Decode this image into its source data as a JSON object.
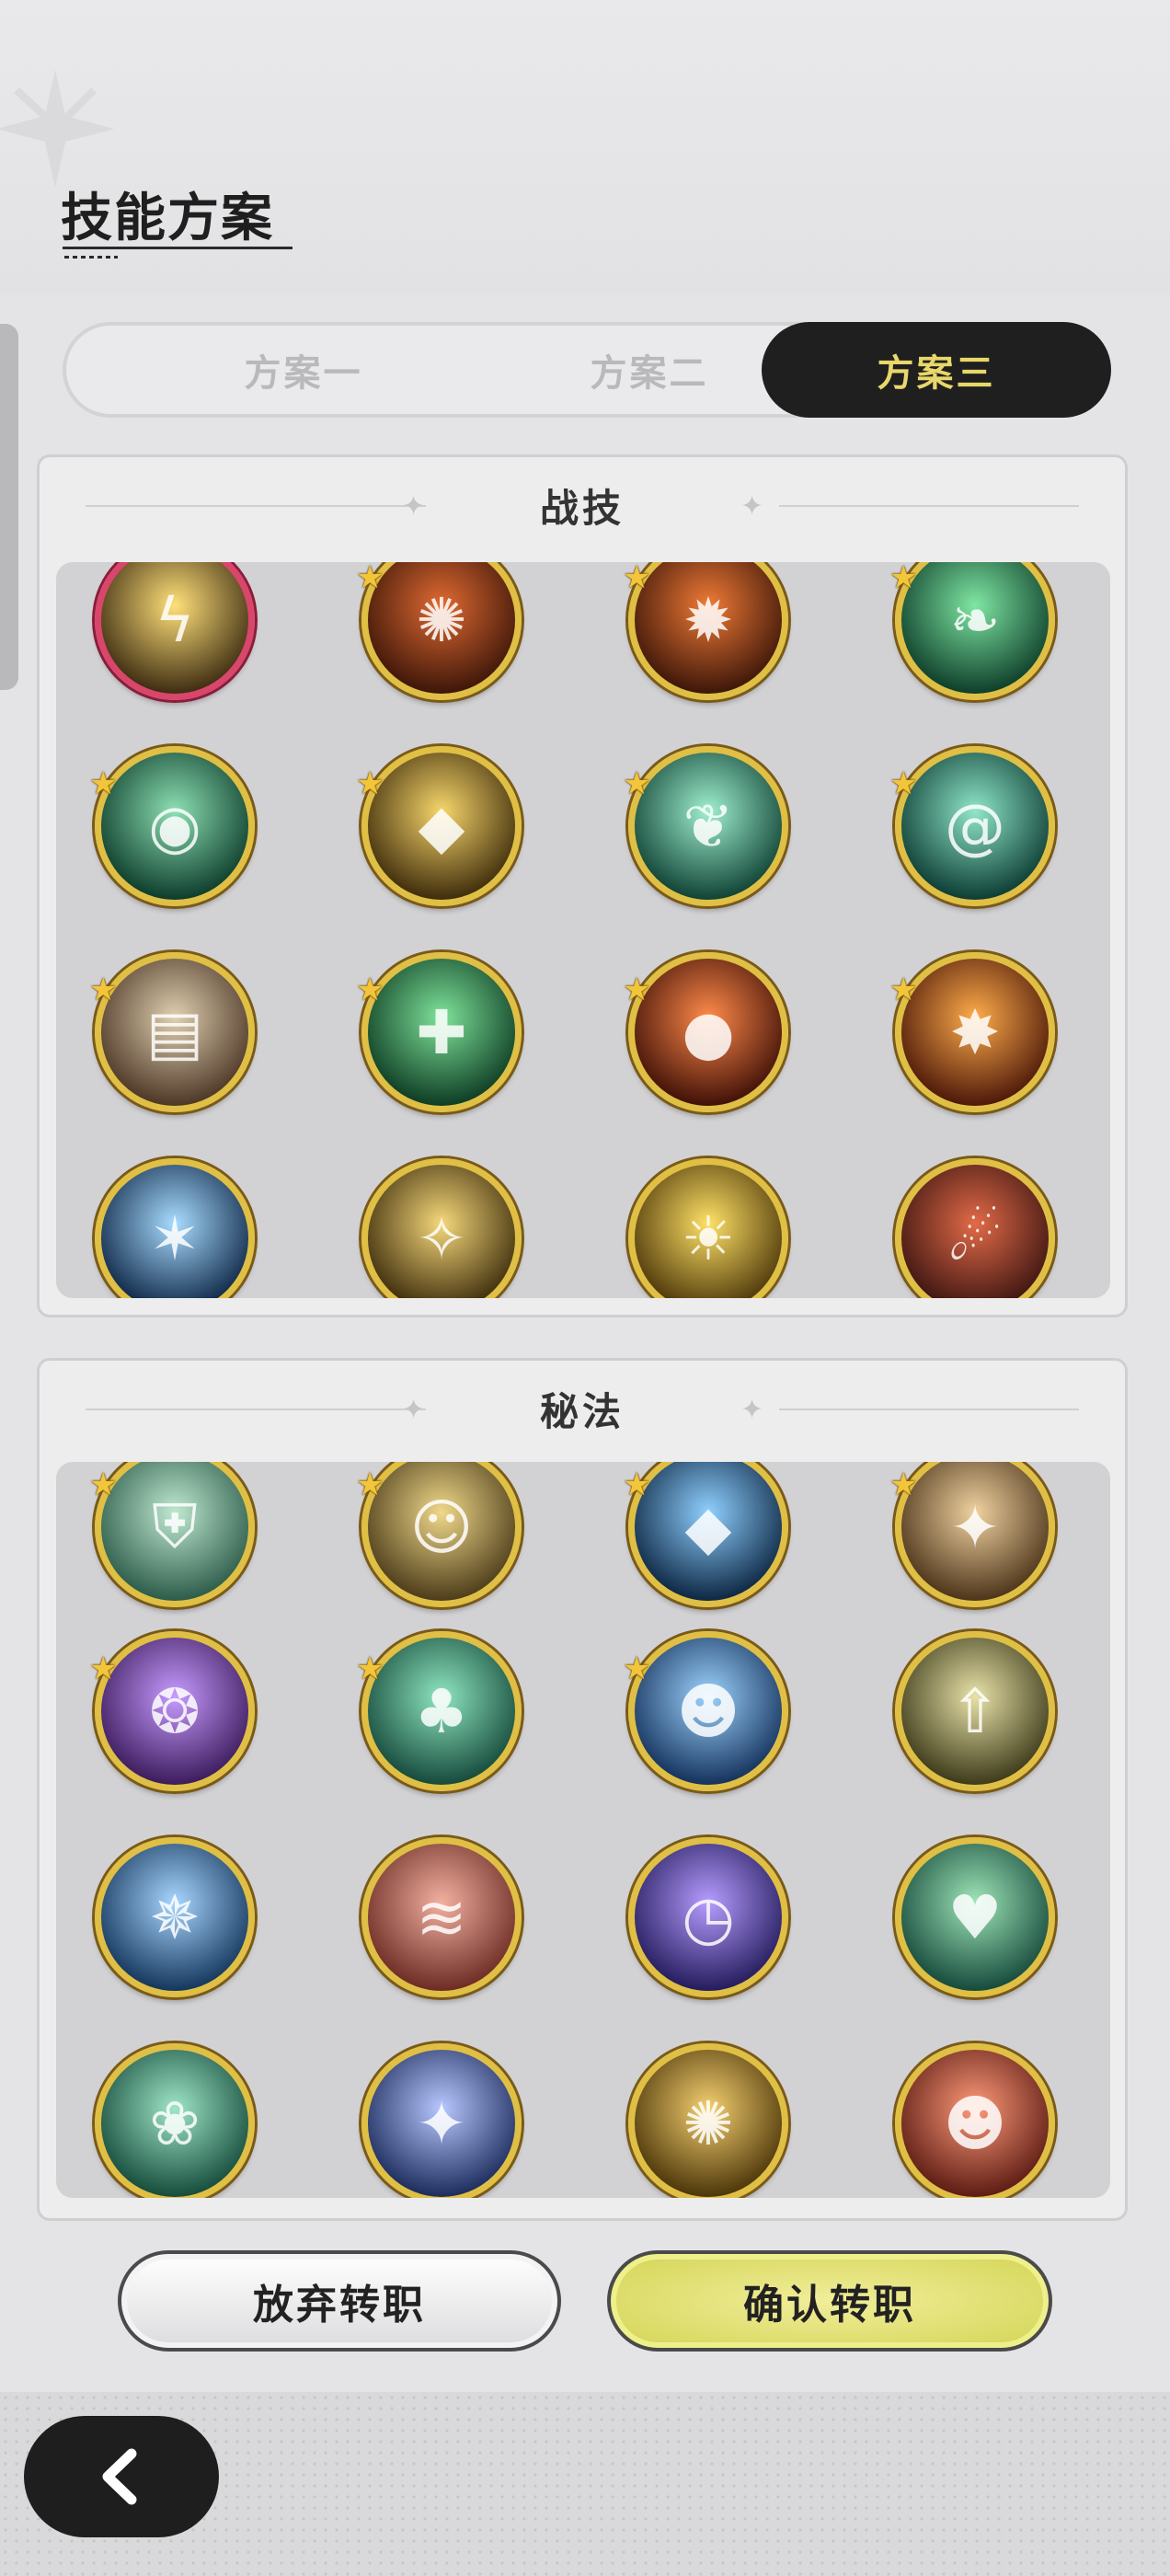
{
  "header": {
    "title": "技能方案"
  },
  "tabs": [
    {
      "label": "方案一",
      "active": false
    },
    {
      "label": "方案二",
      "active": false
    },
    {
      "label": "方案三",
      "active": true
    }
  ],
  "battle_section": {
    "title": "战技",
    "skills": [
      {
        "icon": "lightning-skill-icon",
        "symbol": "ϟ",
        "colors": [
          "#ffe07a",
          "#3b2a10"
        ],
        "starred": false,
        "selected": true
      },
      {
        "icon": "fire-swirl-icon",
        "symbol": "✺",
        "colors": [
          "#e06a32",
          "#3b1508"
        ],
        "starred": true,
        "selected": false
      },
      {
        "icon": "fire-mountain-icon",
        "symbol": "✹",
        "colors": [
          "#f07a36",
          "#3a1508"
        ],
        "starred": true,
        "selected": false
      },
      {
        "icon": "green-wind-icon",
        "symbol": "❧",
        "colors": [
          "#7fe6a3",
          "#0c3c28"
        ],
        "starred": true,
        "selected": false
      },
      {
        "icon": "green-orb-icon",
        "symbol": "◉",
        "colors": [
          "#8de0b3",
          "#0b3a2a"
        ],
        "starred": true,
        "selected": false
      },
      {
        "icon": "golden-crystal-icon",
        "symbol": "◆",
        "colors": [
          "#f7d66b",
          "#3c2a0a"
        ],
        "starred": true,
        "selected": false
      },
      {
        "icon": "wind-blades-icon",
        "symbol": "❦",
        "colors": [
          "#9ff0cf",
          "#0e4033"
        ],
        "starred": true,
        "selected": false
      },
      {
        "icon": "vortex-icon",
        "symbol": "@",
        "colors": [
          "#8fe6c8",
          "#0b3a32"
        ],
        "starred": true,
        "selected": false
      },
      {
        "icon": "stone-cards-icon",
        "symbol": "▤",
        "colors": [
          "#e0cfb0",
          "#4a3524"
        ],
        "starred": true,
        "selected": false
      },
      {
        "icon": "heal-cross-icon",
        "symbol": "✚",
        "colors": [
          "#7fe39a",
          "#0c3a22"
        ],
        "starred": true,
        "selected": false
      },
      {
        "icon": "fireball-icon",
        "symbol": "●",
        "colors": [
          "#ff8a4a",
          "#3e0f06"
        ],
        "starred": true,
        "selected": false
      },
      {
        "icon": "fire-burst-icon",
        "symbol": "✸",
        "colors": [
          "#ffac4a",
          "#4a1608"
        ],
        "starred": true,
        "selected": false
      },
      {
        "icon": "ice-shatter-icon",
        "symbol": "✶",
        "colors": [
          "#a8dcff",
          "#0c2444"
        ],
        "starred": false,
        "selected": false
      },
      {
        "icon": "golden-spark-icon",
        "symbol": "✧",
        "colors": [
          "#f5d77a",
          "#3a2a0a"
        ],
        "starred": false,
        "selected": false
      },
      {
        "icon": "sun-rise-icon",
        "symbol": "☀",
        "colors": [
          "#ffe166",
          "#4a3408"
        ],
        "starred": false,
        "selected": false
      },
      {
        "icon": "flame-meteor-icon",
        "symbol": "☄",
        "colors": [
          "#e26a48",
          "#3a1410"
        ],
        "starred": false,
        "selected": false
      }
    ]
  },
  "secret_section": {
    "title": "秘法",
    "skills": [
      {
        "icon": "green-shield-icon",
        "symbol": "⛨",
        "colors": [
          "#bfe8d0",
          "#2a5a48"
        ],
        "starred": true
      },
      {
        "icon": "golden-figure-icon",
        "symbol": "☺",
        "colors": [
          "#f0d88a",
          "#4a3a18"
        ],
        "starred": true
      },
      {
        "icon": "blue-crystal-icon",
        "symbol": "◆",
        "colors": [
          "#8fd0ff",
          "#0b2440"
        ],
        "starred": true
      },
      {
        "icon": "golden-sword-icon",
        "symbol": "✦",
        "colors": [
          "#f0d2a0",
          "#4a3218"
        ],
        "starred": true
      },
      {
        "icon": "purple-swirl-icon",
        "symbol": "❂",
        "colors": [
          "#c79bff",
          "#3a1a5a"
        ],
        "starred": true
      },
      {
        "icon": "green-clover-icon",
        "symbol": "♣",
        "colors": [
          "#8fe6c0",
          "#14483a"
        ],
        "starred": true
      },
      {
        "icon": "blue-person-icon",
        "symbol": "☻",
        "colors": [
          "#9ed4ff",
          "#12305a"
        ],
        "starred": true
      },
      {
        "icon": "golden-arrow-up-icon",
        "symbol": "⇧",
        "colors": [
          "#e8e2a8",
          "#3a3818"
        ],
        "starred": false
      },
      {
        "icon": "ice-spikes-icon",
        "symbol": "✵",
        "colors": [
          "#a8d6ff",
          "#12345a"
        ],
        "starred": false
      },
      {
        "icon": "coral-wave-icon",
        "symbol": "≋",
        "colors": [
          "#f2b0a0",
          "#6a2a22"
        ],
        "starred": false
      },
      {
        "icon": "purple-clock-icon",
        "symbol": "◷",
        "colors": [
          "#b69cff",
          "#221a5a"
        ],
        "starred": false
      },
      {
        "icon": "green-heart-icon",
        "symbol": "♥",
        "colors": [
          "#9fe6b8",
          "#14483a"
        ],
        "starred": false
      },
      {
        "icon": "jade-chain-icon",
        "symbol": "❀",
        "colors": [
          "#9fe6c8",
          "#144a3a"
        ],
        "starred": false
      },
      {
        "icon": "star-gem-icon",
        "symbol": "✦",
        "colors": [
          "#b8c8ff",
          "#1a2a5a"
        ],
        "starred": false
      },
      {
        "icon": "golden-burst-icon",
        "symbol": "✺",
        "colors": [
          "#f5d070",
          "#4a3408"
        ],
        "starred": false
      },
      {
        "icon": "fire-person-icon",
        "symbol": "☻",
        "colors": [
          "#ff9a7a",
          "#5a1a12"
        ],
        "starred": false
      }
    ]
  },
  "buttons": {
    "abandon": "放弃转职",
    "confirm": "确认转职"
  },
  "nav": {
    "back_icon": "chevron-left-icon"
  }
}
